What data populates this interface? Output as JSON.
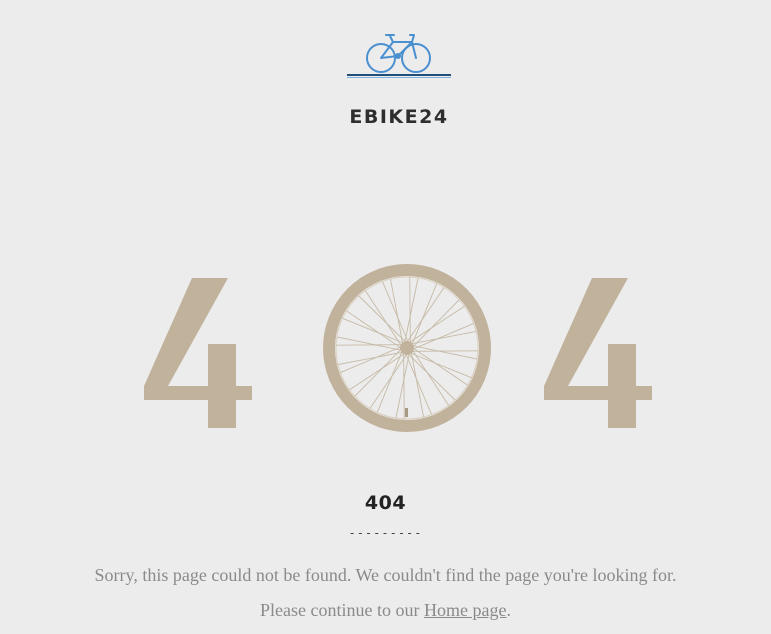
{
  "logo": {
    "text": "EBIKE24",
    "icon": "bicycle-icon",
    "colors": {
      "bike": "#4a8fd0",
      "line_top": "#1f4e79",
      "line_bottom": "#7fb2e0"
    }
  },
  "hero": {
    "digit_left": "4",
    "digit_right": "4",
    "middle_icon": "bike-wheel-icon",
    "color": "#c0b29b"
  },
  "error": {
    "code": "404",
    "divider": "---------"
  },
  "message": {
    "line1": "Sorry, this page could not be found. We couldn't find the page you're looking for.",
    "line2_prefix": "Please continue to our ",
    "link_label": "Home page",
    "line2_suffix": "."
  }
}
